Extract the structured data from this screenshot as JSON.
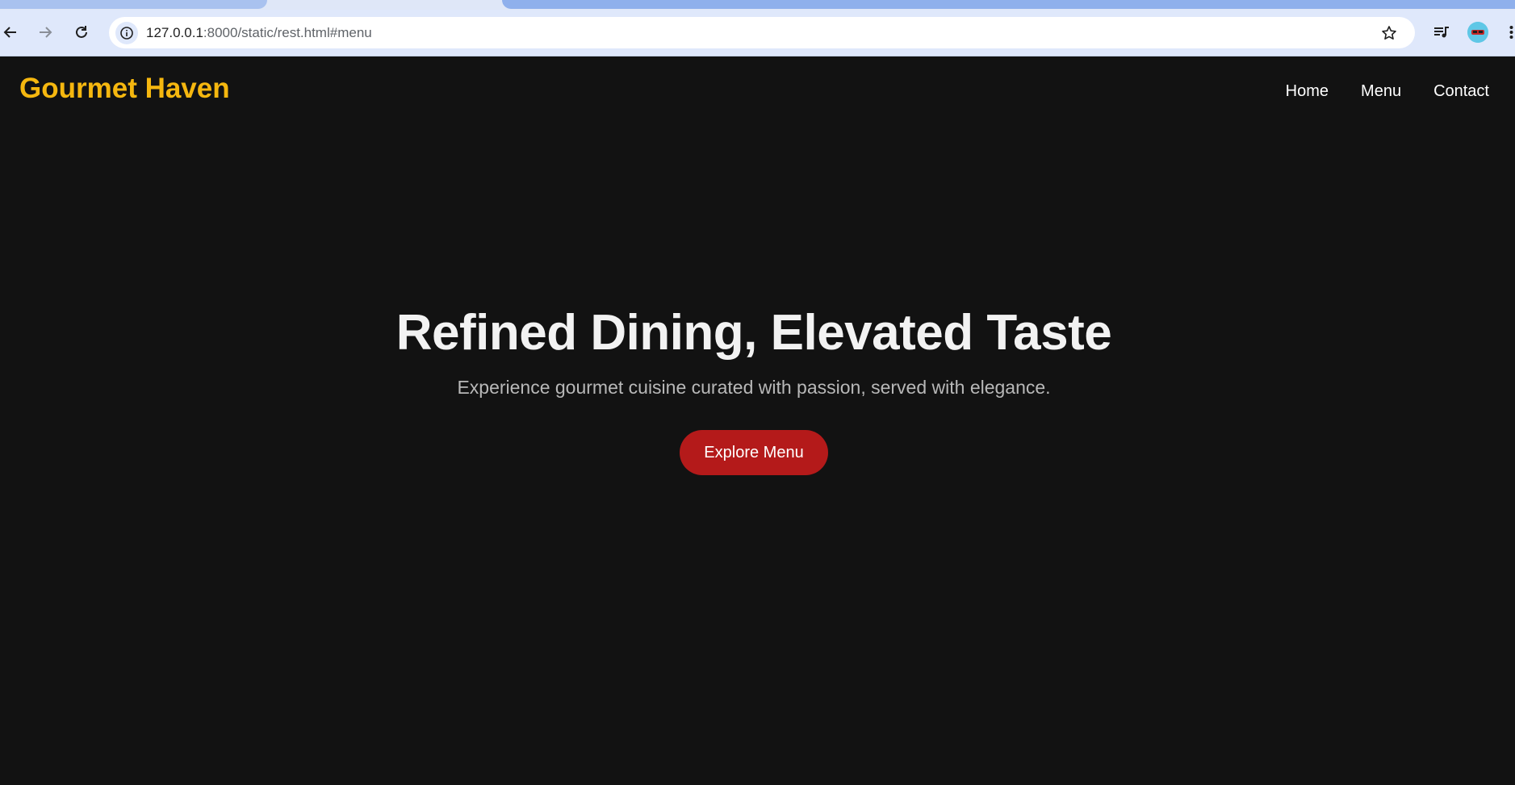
{
  "browser": {
    "url_host": "127.0.0.1",
    "url_rest": ":8000/static/rest.html#menu",
    "icons": {
      "back": "arrow-left-icon",
      "forward": "arrow-right-icon",
      "reload": "reload-icon",
      "site_info": "info-icon",
      "bookmark": "star-icon",
      "media": "playlist-icon",
      "profile": "avatar",
      "menu": "kebab-menu-icon"
    }
  },
  "header": {
    "logo": "Gourmet Haven",
    "nav": [
      {
        "label": "Home"
      },
      {
        "label": "Menu"
      },
      {
        "label": "Contact"
      }
    ]
  },
  "hero": {
    "title": "Refined Dining, Elevated Taste",
    "subtitle": "Experience gourmet cuisine curated with passion, served with elegance.",
    "cta_label": "Explore Menu"
  },
  "colors": {
    "page_background": "#121212",
    "logo": "#f5b70f",
    "cta_background": "#b41a1a",
    "hero_title": "#f2f2f2",
    "hero_subtitle": "#b8b8b8"
  }
}
